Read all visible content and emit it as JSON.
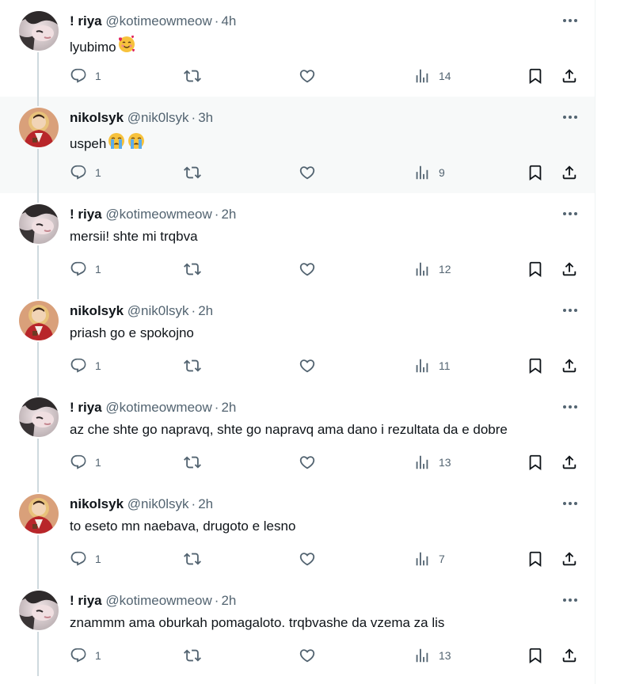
{
  "users": {
    "riya": {
      "display_name": "! riya",
      "handle": "@kotimeowmeow"
    },
    "nikolsyk": {
      "display_name": "nikolsyk",
      "handle": "@nik0lsyk"
    }
  },
  "tweets": [
    {
      "user": "riya",
      "display_name": "! riya",
      "handle": "@kotimeowmeow",
      "time": "4h",
      "text": "lyubimo",
      "emoji": [
        "smiling-face-with-hearts"
      ],
      "replies": "1",
      "retweets": "",
      "likes": "",
      "views": "14"
    },
    {
      "user": "nikolsyk",
      "display_name": "nikolsyk",
      "handle": "@nik0lsyk",
      "time": "3h",
      "text": "uspeh",
      "emoji": [
        "loudly-crying-face",
        "loudly-crying-face"
      ],
      "replies": "1",
      "retweets": "",
      "likes": "",
      "views": "9"
    },
    {
      "user": "riya",
      "display_name": "! riya",
      "handle": "@kotimeowmeow",
      "time": "2h",
      "text": "mersii! shte mi trqbva",
      "emoji": [],
      "replies": "1",
      "retweets": "",
      "likes": "",
      "views": "12"
    },
    {
      "user": "nikolsyk",
      "display_name": "nikolsyk",
      "handle": "@nik0lsyk",
      "time": "2h",
      "text": "priash go e spokojno",
      "emoji": [],
      "replies": "1",
      "retweets": "",
      "likes": "",
      "views": "11"
    },
    {
      "user": "riya",
      "display_name": "! riya",
      "handle": "@kotimeowmeow",
      "time": "2h",
      "text": "az che shte go napravq, shte go napravq ama dano i rezultata da e dobre",
      "emoji": [],
      "replies": "1",
      "retweets": "",
      "likes": "",
      "views": "13"
    },
    {
      "user": "nikolsyk",
      "display_name": "nikolsyk",
      "handle": "@nik0lsyk",
      "time": "2h",
      "text": "to eseto mn naebava, drugoto e lesno",
      "emoji": [],
      "replies": "1",
      "retweets": "",
      "likes": "",
      "views": "7"
    },
    {
      "user": "riya",
      "display_name": "! riya",
      "handle": "@kotimeowmeow",
      "time": "2h",
      "text": "znammm ama oburkah pomagaloto. trqbvashe da vzema za lis",
      "emoji": [],
      "replies": "1",
      "retweets": "",
      "likes": "",
      "views": "13"
    }
  ],
  "colors": {
    "text": "#0f1419",
    "secondary": "#536471",
    "thread_line": "#cfd9de",
    "hover_bg": "#f7f9f9",
    "divider": "#eff3f4"
  },
  "icons": {
    "reply": "reply-icon",
    "retweet": "retweet-icon",
    "like": "like-icon",
    "views": "views-icon",
    "bookmark": "bookmark-icon",
    "share": "share-icon",
    "more": "more-icon"
  }
}
